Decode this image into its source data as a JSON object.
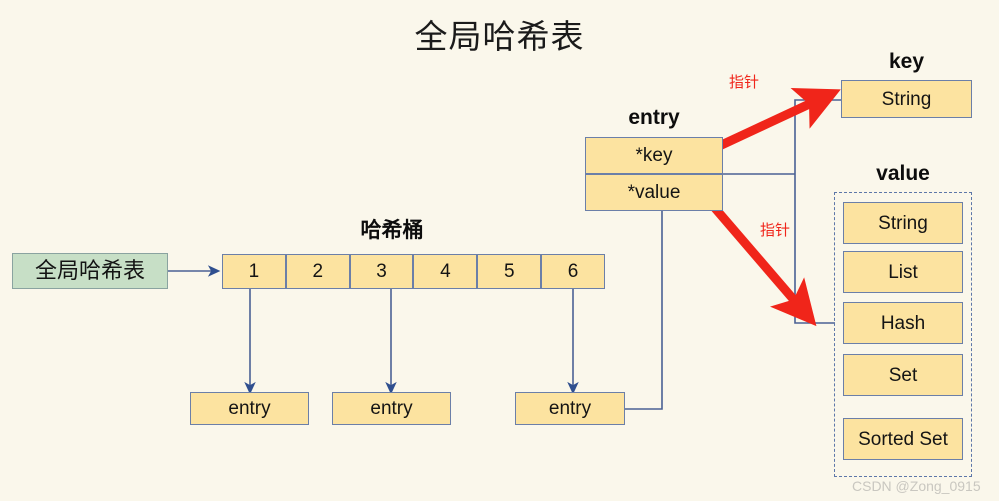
{
  "title": "全局哈希表",
  "global_table": {
    "label": "全局哈希表"
  },
  "bucket": {
    "label": "哈希桶",
    "cells": [
      "1",
      "2",
      "3",
      "4",
      "5",
      "6"
    ]
  },
  "entries": [
    {
      "label": "entry"
    },
    {
      "label": "entry"
    },
    {
      "label": "entry"
    }
  ],
  "entry_struct": {
    "label": "entry",
    "fields": [
      {
        "label": "*key"
      },
      {
        "label": "*value"
      }
    ]
  },
  "pointers": [
    {
      "label": "指针"
    },
    {
      "label": "指针"
    }
  ],
  "key_section": {
    "label": "key",
    "items": [
      "String"
    ]
  },
  "value_section": {
    "label": "value",
    "items": [
      "String",
      "List",
      "Hash",
      "Set",
      "Sorted Set"
    ]
  },
  "watermark": "CSDN @Zong_0915",
  "colors": {
    "background": "#faf7eb",
    "box_fill": "#fce3a0",
    "box_border": "#6b7fa8",
    "green_fill": "#c7dfc6",
    "green_border": "#8aa3a0",
    "connector": "#4a6194",
    "pointer_red": "#f0251a",
    "dashed_border": "#5d77a8",
    "watermark": "#c9c7c0"
  }
}
